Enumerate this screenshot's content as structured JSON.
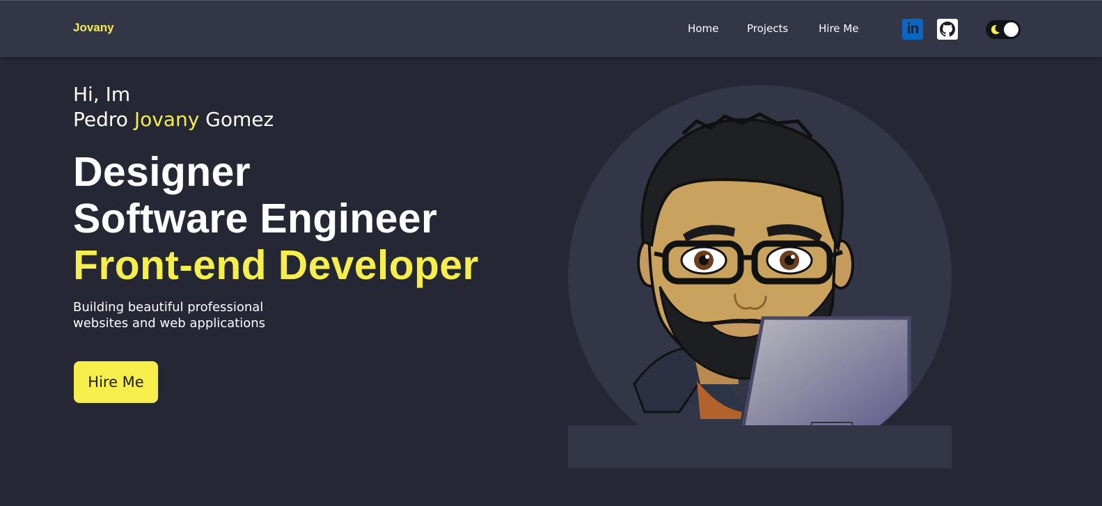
{
  "header": {
    "brand": "Jovany",
    "nav": [
      {
        "label": "Home"
      },
      {
        "label": "Projects"
      },
      {
        "label": "Hire Me"
      }
    ],
    "social": [
      {
        "icon": "linkedin-icon",
        "text": "in"
      },
      {
        "icon": "github-icon"
      }
    ],
    "theme_toggle": {
      "icon": "moon-icon",
      "state": "dark"
    }
  },
  "hero": {
    "greeting_line1": "Hi, Im",
    "name_first": "Pedro",
    "name_highlight": "Jovany",
    "name_last": "Gomez",
    "roles": [
      "Designer",
      "Software Engineer",
      "Front-end Developer"
    ],
    "tagline_line1": "Building beautiful professional",
    "tagline_line2": "websites and web applications",
    "cta_label": "Hire Me",
    "avatar_icon": "developer-avatar-illustration"
  },
  "colors": {
    "background": "#252734",
    "navbar": "#333647",
    "accent": "#f5ee4b",
    "text": "#ffffff"
  }
}
